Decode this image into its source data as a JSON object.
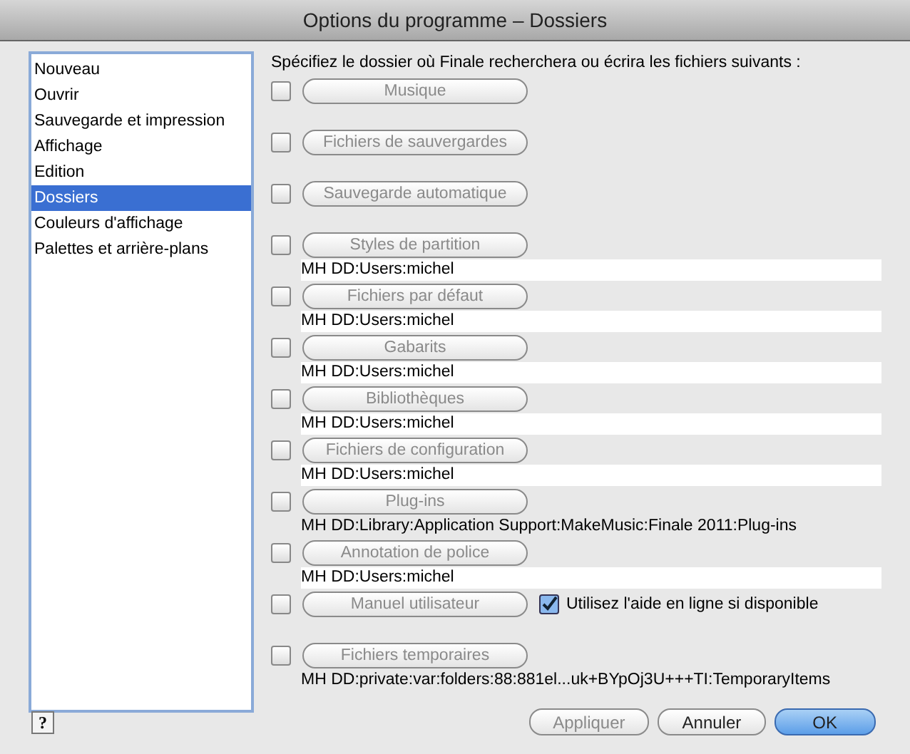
{
  "window": {
    "title": "Options du programme – Dossiers"
  },
  "sidebar": {
    "items": [
      {
        "label": "Nouveau",
        "selected": false
      },
      {
        "label": "Ouvrir",
        "selected": false
      },
      {
        "label": "Sauvegarde et impression",
        "selected": false
      },
      {
        "label": "Affichage",
        "selected": false
      },
      {
        "label": "Edition",
        "selected": false
      },
      {
        "label": "Dossiers",
        "selected": true
      },
      {
        "label": "Couleurs d'affichage",
        "selected": false
      },
      {
        "label": "Palettes et arrière-plans",
        "selected": false
      }
    ]
  },
  "instructions": "Spécifiez le dossier où Finale recherchera ou écrira les fichiers suivants :",
  "folders": [
    {
      "kind": "button",
      "label": "Musique",
      "checked": false,
      "disabled": true
    },
    {
      "kind": "button",
      "label": "Fichiers de sauvergardes",
      "checked": false,
      "disabled": true
    },
    {
      "kind": "button",
      "label": "Sauvegarde automatique",
      "checked": false,
      "disabled": true
    },
    {
      "kind": "field",
      "label": "Styles de partition",
      "checked": false,
      "disabled": true,
      "path": "MH DD:Users:michel"
    },
    {
      "kind": "field",
      "label": "Fichiers par défaut",
      "checked": false,
      "disabled": true,
      "path": "MH DD:Users:michel"
    },
    {
      "kind": "field",
      "label": "Gabarits",
      "checked": false,
      "disabled": true,
      "path": "MH DD:Users:michel"
    },
    {
      "kind": "field",
      "label": "Bibliothèques",
      "checked": false,
      "disabled": true,
      "path": "MH DD:Users:michel"
    },
    {
      "kind": "field",
      "label": "Fichiers de configuration",
      "checked": false,
      "disabled": true,
      "path": "MH DD:Users:michel"
    },
    {
      "kind": "plain",
      "label": "Plug-ins",
      "checked": false,
      "disabled": true,
      "path": "MH DD:Library:Application Support:MakeMusic:Finale 2011:Plug-ins"
    },
    {
      "kind": "field",
      "label": "Annotation de police",
      "checked": false,
      "disabled": true,
      "path": "MH DD:Users:michel"
    },
    {
      "kind": "option",
      "label": "Manuel utilisateur",
      "checked": false,
      "disabled": true,
      "option": {
        "label": "Utilisez l'aide en ligne si disponible",
        "checked": true
      }
    },
    {
      "kind": "plain",
      "label": "Fichiers temporaires",
      "checked": false,
      "disabled": true,
      "path": "MH DD:private:var:folders:88:881el...uk+BYpOj3U+++TI:TemporaryItems"
    }
  ],
  "help_button": "?",
  "buttons": [
    {
      "label": "Appliquer",
      "kind": "normal",
      "disabled": true
    },
    {
      "label": "Annuler",
      "kind": "normal",
      "disabled": false
    },
    {
      "label": "OK",
      "kind": "default",
      "disabled": false
    }
  ]
}
